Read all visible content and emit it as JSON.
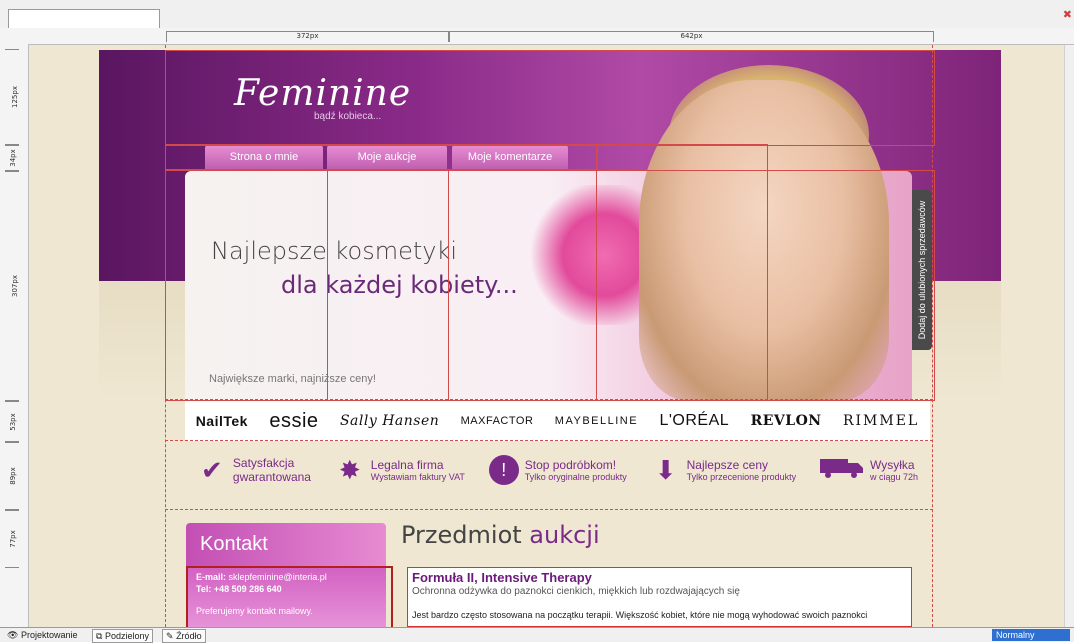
{
  "ruler": {
    "h_labels": [
      "372px",
      "642px"
    ],
    "v_labels": [
      "125px",
      "34px",
      "307px",
      "53px",
      "89px",
      "77px"
    ]
  },
  "site": {
    "logo": "Feminine",
    "tagline": "bądź kobieca...",
    "nav": [
      "Strona o mnie",
      "Moje aukcje",
      "Moje komentarze"
    ],
    "headline_1": "Najlepsze kosmetyki",
    "headline_2": "dla każdej kobiety...",
    "slogan": "Największe marki, najniższe ceny!",
    "side_tab": "Dodaj do ulubionych sprzedawców",
    "brands": [
      "NailTek",
      "essie",
      "Sally Hansen",
      "MAXFACTOR",
      "MAYBELLINE",
      "L'ORÉAL",
      "REVLON",
      "RIMMEL"
    ],
    "features": [
      {
        "icon": "checkmark-icon",
        "title": "Satysfakcja",
        "sub": "gwarantowana"
      },
      {
        "icon": "star-burst-icon",
        "title": "Legalna firma",
        "sub": "Wystawiam faktury VAT"
      },
      {
        "icon": "exclamation-icon",
        "title": "Stop podróbkom!",
        "sub": "Tylko oryginalne produkty"
      },
      {
        "icon": "down-arrow-icon",
        "title": "Najlepsze ceny",
        "sub": "Tylko przecenione produkty"
      },
      {
        "icon": "truck-icon",
        "title": "Wysyłka",
        "sub": "w ciągu 72h"
      }
    ],
    "contact": {
      "title": "Kontakt",
      "email_label": "E-mail:",
      "email": "sklepfeminine@interia.pl",
      "tel_label": "Tel:",
      "tel": "+48 509 286 640",
      "note": "Preferujemy kontakt mailowy."
    },
    "section_title": "Przedmiot",
    "section_title_accent": "aukcji",
    "product": {
      "title": "Formuła II, Intensive Therapy",
      "subtitle": "Ochronna odżywka do paznokci cienkich, miękkich lub rozdwajających się",
      "description": "Jest bardzo często stosowana na początku terapii. Większość kobiet, które nie mogą wyhodować swoich paznokci"
    }
  },
  "statusbar": {
    "design": "Projektowanie",
    "split": "Podzielony",
    "source": "Źródło",
    "mode": "Normalny"
  },
  "colors": {
    "accent": "#7a2a88",
    "guide": "#d24a4a",
    "background": "#efe7d2"
  }
}
